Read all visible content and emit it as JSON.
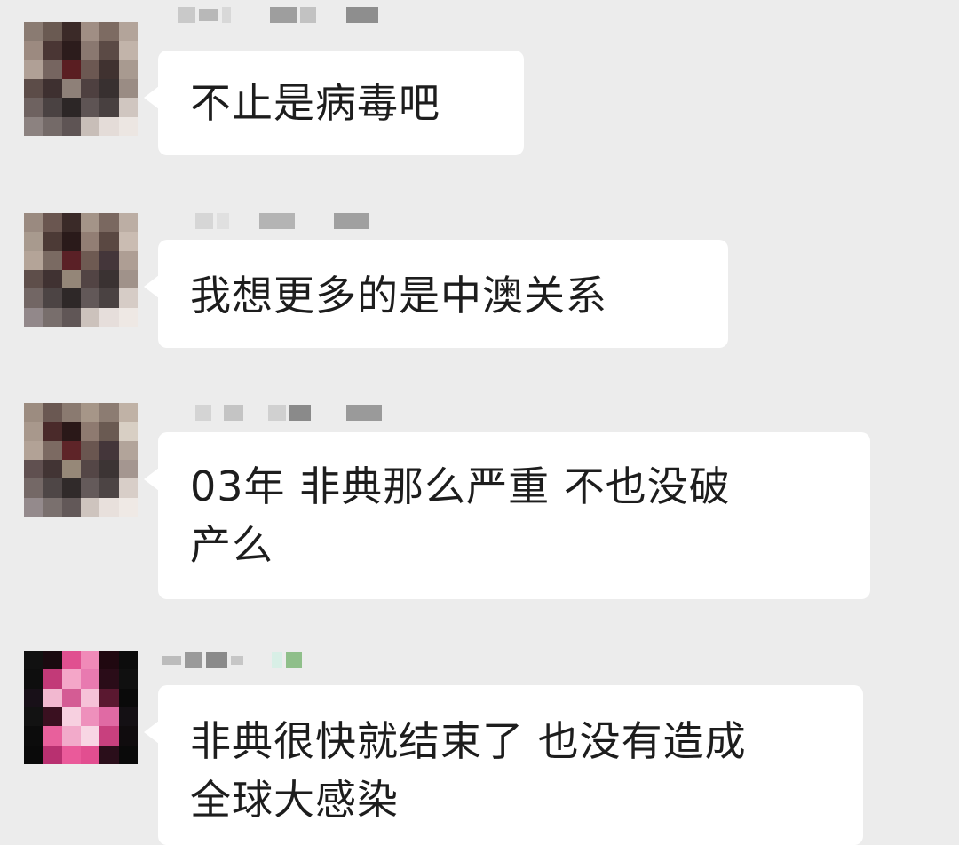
{
  "chat": {
    "messages": [
      {
        "id": "m1",
        "text": "不止是病毒吧"
      },
      {
        "id": "m2",
        "text": "我想更多的是中澳关系"
      },
      {
        "id": "m3",
        "text": "03年 非典那么严重 不也没破\n产么"
      },
      {
        "id": "m4",
        "text": "非典很快就结束了 也没有造成\n全球大感染"
      }
    ]
  },
  "colors": {
    "background": "#ececec",
    "bubble": "#ffffff",
    "text": "#1d1d1d"
  }
}
